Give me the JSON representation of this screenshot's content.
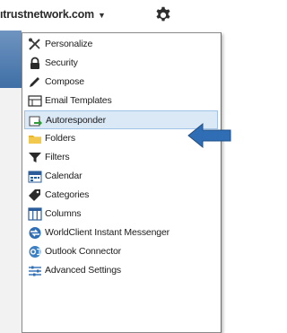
{
  "header": {
    "account_label": "ıtrustnetwork.com",
    "dropdown_arrow": "▼",
    "settings_icon": "gear-icon"
  },
  "menu": {
    "items": [
      {
        "label": "Personalize",
        "icon": "personalize-icon"
      },
      {
        "label": "Security",
        "icon": "lock-icon"
      },
      {
        "label": "Compose",
        "icon": "pencil-icon"
      },
      {
        "label": "Email Templates",
        "icon": "template-icon"
      },
      {
        "label": "Autoresponder",
        "icon": "autoresponder-icon",
        "selected": true
      },
      {
        "label": "Folders",
        "icon": "folder-icon"
      },
      {
        "label": "Filters",
        "icon": "filter-icon"
      },
      {
        "label": "Calendar",
        "icon": "calendar-icon"
      },
      {
        "label": "Categories",
        "icon": "tag-icon"
      },
      {
        "label": "Columns",
        "icon": "columns-icon"
      },
      {
        "label": "WorldClient Instant Messenger",
        "icon": "messenger-icon"
      },
      {
        "label": "Outlook Connector",
        "icon": "outlook-connector-icon"
      },
      {
        "label": "Advanced Settings",
        "icon": "advanced-settings-icon"
      }
    ]
  },
  "annotation": {
    "icon": "arrow-left-icon",
    "color": "#2f6db5"
  },
  "colors": {
    "accent": "#3f6fa6",
    "selection": "#dbe9f7",
    "folder": "#e8b52c"
  }
}
